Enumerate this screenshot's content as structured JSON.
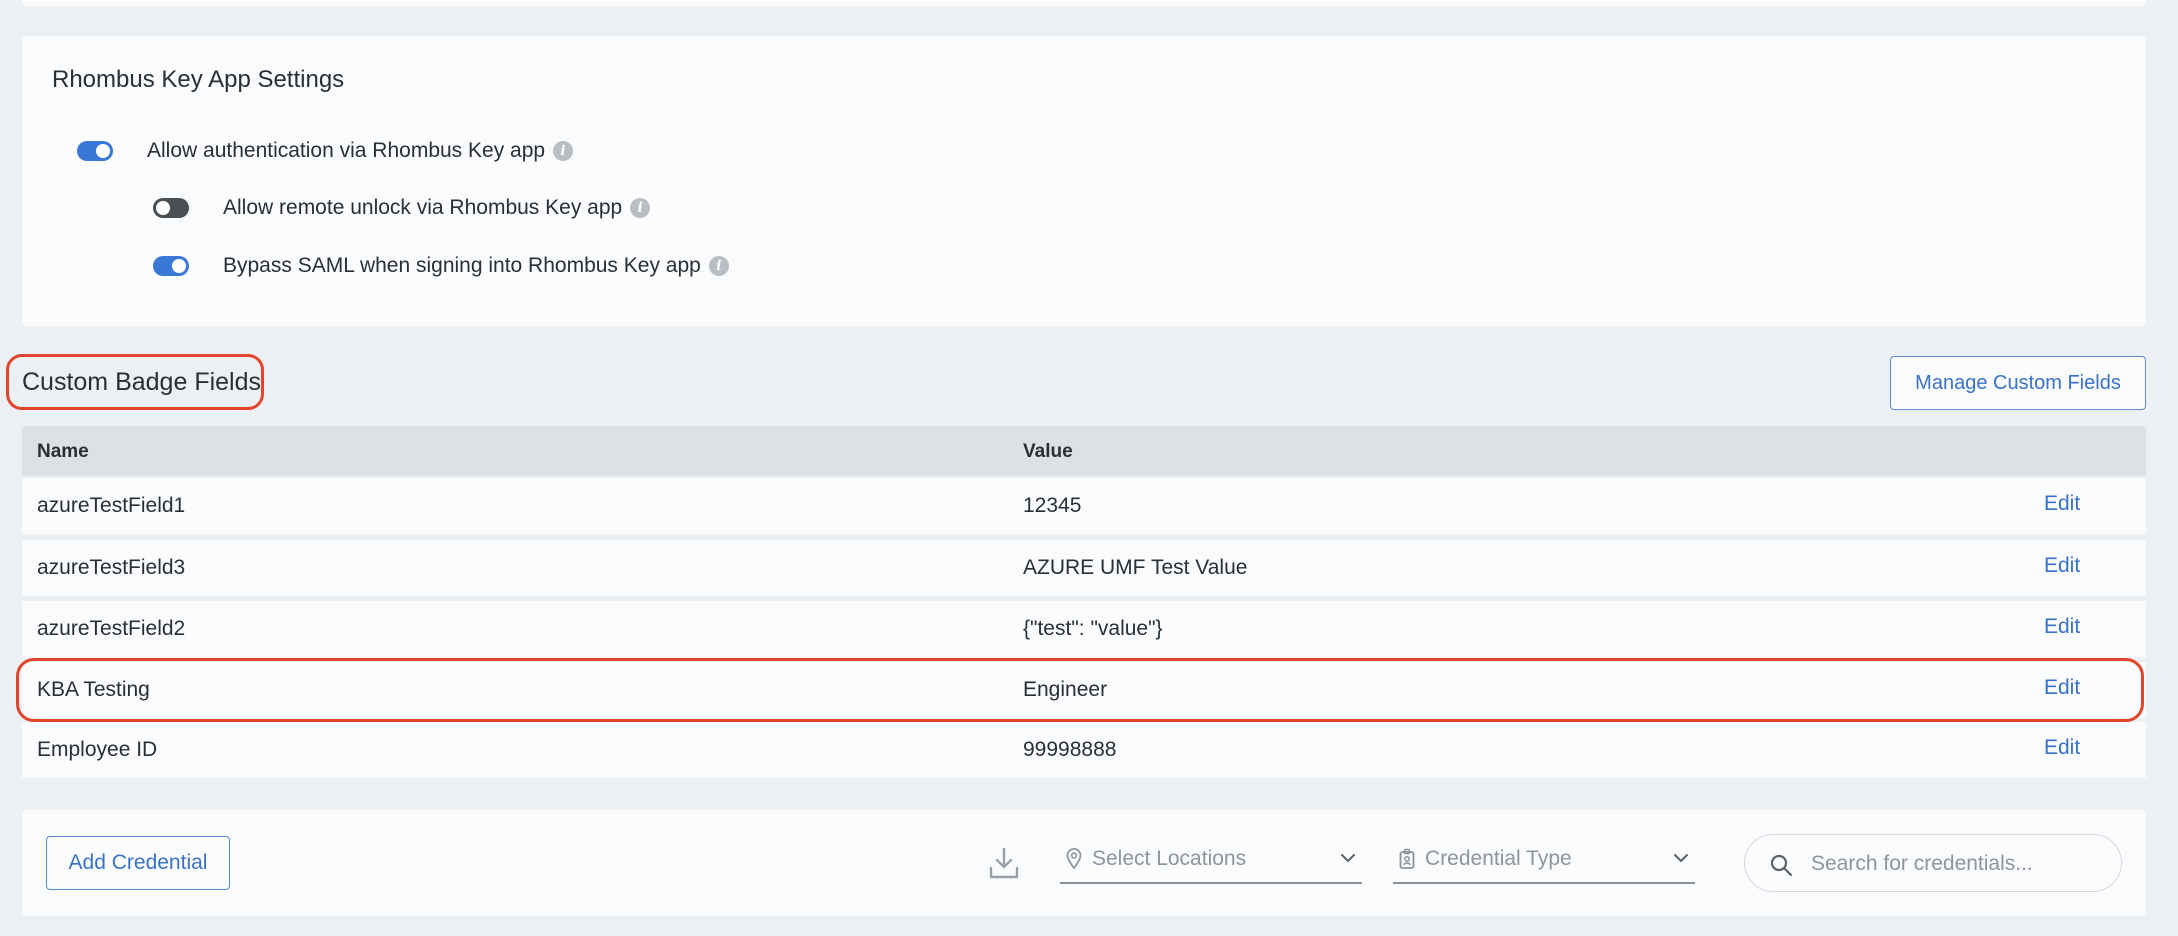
{
  "settings": {
    "title": "Rhombus Key App Settings",
    "toggles": [
      {
        "label": "Allow authentication via Rhombus Key app",
        "state": "on"
      },
      {
        "label": "Allow remote unlock via Rhombus Key app",
        "state": "off"
      },
      {
        "label": "Bypass SAML when signing into Rhombus Key app",
        "state": "on"
      }
    ]
  },
  "custom_badge": {
    "title": "Custom Badge Fields",
    "manage_button": "Manage Custom Fields",
    "columns": {
      "name": "Name",
      "value": "Value"
    },
    "edit_label": "Edit",
    "rows": [
      {
        "name": "azureTestField1",
        "value": "12345"
      },
      {
        "name": "azureTestField3",
        "value": "AZURE UMF Test Value"
      },
      {
        "name": "azureTestField2",
        "value": "{\"test\": \"value\"}"
      },
      {
        "name": "KBA Testing",
        "value": "Engineer"
      },
      {
        "name": "Employee ID",
        "value": "99998888"
      }
    ]
  },
  "credentials_toolbar": {
    "add_button": "Add Credential",
    "locations_select": "Select Locations",
    "type_select": "Credential Type",
    "search_placeholder": "Search for credentials..."
  },
  "colors": {
    "accent": "#3a72c9",
    "highlight": "#e2452b",
    "toggle_on": "#3a78d8",
    "toggle_off": "#4a4f55"
  }
}
